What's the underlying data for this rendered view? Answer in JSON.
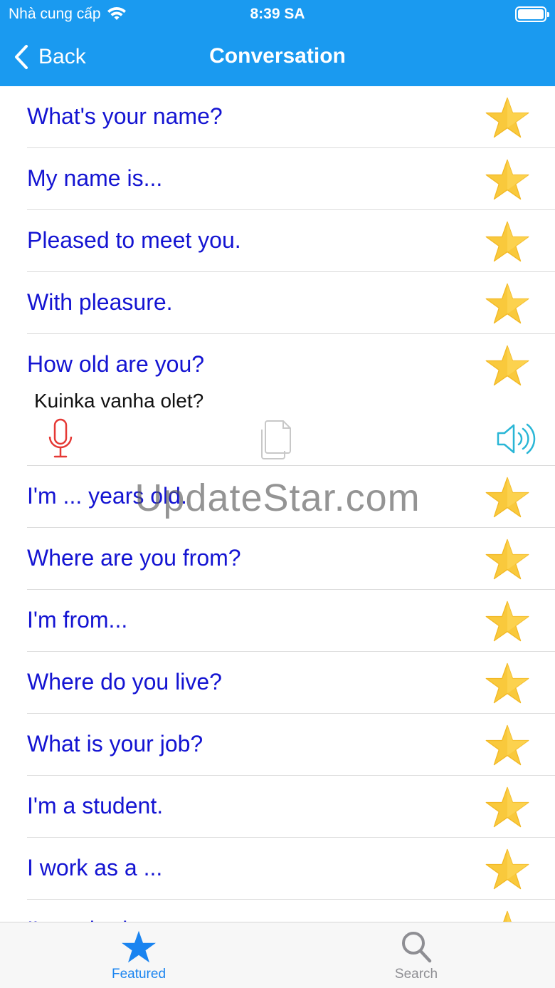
{
  "status_bar": {
    "carrier": "Nhà cung cấp",
    "time": "8:39 SA"
  },
  "nav": {
    "back_label": "Back",
    "title": "Conversation"
  },
  "phrases": [
    {
      "text": "What's your name?"
    },
    {
      "text": "My name is..."
    },
    {
      "text": "Pleased to meet you."
    },
    {
      "text": "With pleasure."
    },
    {
      "text": "How old are you?",
      "translation": "Kuinka vanha olet?"
    },
    {
      "text": "I'm ... years old."
    },
    {
      "text": "Where are you from?"
    },
    {
      "text": "I'm from..."
    },
    {
      "text": "Where do you live?"
    },
    {
      "text": "What is your job?"
    },
    {
      "text": "I'm a student."
    },
    {
      "text": "I work as a ..."
    },
    {
      "text": "I'm retired."
    }
  ],
  "watermark": "UpdateStar.com",
  "tabs": {
    "featured": "Featured",
    "search": "Search"
  },
  "colors": {
    "accent": "#1a9af0",
    "phrase_text": "#1414d2",
    "mic": "#e53935",
    "speaker": "#29b6d6",
    "star": "#f9c93c"
  }
}
